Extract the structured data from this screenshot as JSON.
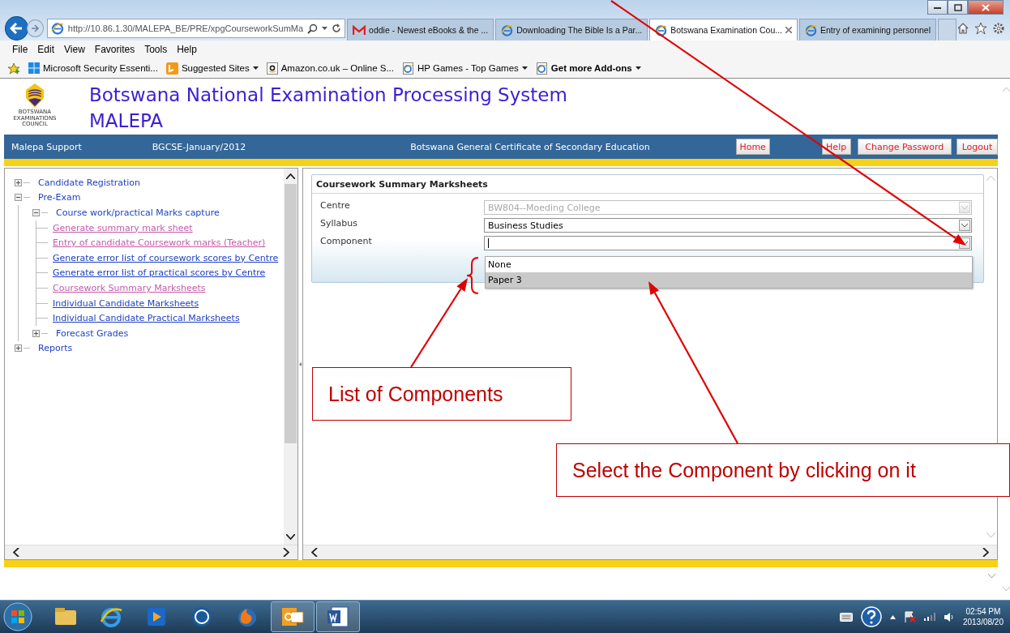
{
  "browser": {
    "address": "http://10.86.1.30/MALEPA_BE/PRE/xpgCourseworkSumMa",
    "tabs": [
      {
        "label": "oddie - Newest eBooks & the ...",
        "kind": "mail",
        "selected": false
      },
      {
        "label": "Downloading The Bible Is a Par...",
        "kind": "web",
        "selected": false
      },
      {
        "label": "Botswana Examination Cou...",
        "kind": "web",
        "selected": true
      },
      {
        "label": "Entry of examining personnel",
        "kind": "web",
        "selected": false
      }
    ],
    "menu": [
      "File",
      "Edit",
      "View",
      "Favorites",
      "Tools",
      "Help"
    ],
    "favorites": [
      {
        "label": "Microsoft Security Essenti...",
        "kind": "windows",
        "has_menu": false,
        "bold": false
      },
      {
        "label": "Suggested Sites",
        "kind": "bing",
        "has_menu": true,
        "bold": false
      },
      {
        "label": "Amazon.co.uk – Online S...",
        "kind": "amazon",
        "has_menu": false,
        "bold": false
      },
      {
        "label": "HP Games - Top Games",
        "kind": "page",
        "has_menu": true,
        "bold": false
      },
      {
        "label": "Get more Add-ons",
        "kind": "page",
        "has_menu": true,
        "bold": true
      }
    ]
  },
  "header": {
    "logo_caption": "BOTSWANA EXAMINATIONS COUNCIL",
    "title": "Botswana National Examination Processing System",
    "subtitle": "MALEPA"
  },
  "nav_bar": {
    "items": [
      "Malepa Support",
      "BGCSE-January/2012",
      "Botswana General Certificate of Secondary Education"
    ],
    "buttons": [
      "Home",
      "Help",
      "Change Password",
      "Logout"
    ]
  },
  "tree": [
    {
      "label": "Candidate Registration",
      "expanded": false
    },
    {
      "label": "Pre-Exam",
      "expanded": true,
      "children": [
        {
          "label": "Course work/practical Marks capture",
          "expanded": true,
          "children": [
            {
              "label": "Generate summary mark sheet",
              "visited": true
            },
            {
              "label": "Entry of candidate Coursework marks (Teacher)",
              "visited": true
            },
            {
              "label": "Generate error list of coursework scores by Centre",
              "visited": false
            },
            {
              "label": "Generate error list of practical scores by Centre",
              "visited": false
            },
            {
              "label": "Coursework Summary Marksheets",
              "visited": true
            },
            {
              "label": "Individual Candidate Marksheets",
              "visited": false
            },
            {
              "label": "Individual Candidate Practical Marksheets",
              "visited": false
            }
          ]
        },
        {
          "label": "Forecast Grades",
          "expanded": false
        }
      ]
    },
    {
      "label": "Reports",
      "expanded": false
    }
  ],
  "form": {
    "title": "Coursework Summary Marksheets",
    "fields": [
      {
        "label": "Centre",
        "value": "BW804--Moeding College",
        "disabled": true
      },
      {
        "label": "Syllabus",
        "value": "Business Studies",
        "disabled": false
      },
      {
        "label": "Component",
        "disabled": false
      }
    ],
    "component_options": [
      {
        "label": "None",
        "selected": false
      },
      {
        "label": "Paper 3",
        "selected": true
      }
    ]
  },
  "annotations": [
    {
      "text": "List of Components"
    },
    {
      "text": "Select the Component by clicking on it"
    }
  ],
  "taskbar": {
    "apps": [
      {
        "kind": "folder",
        "open": false
      },
      {
        "kind": "ie",
        "open": false
      },
      {
        "kind": "media",
        "open": false
      },
      {
        "kind": "hp",
        "open": false
      },
      {
        "kind": "firefox",
        "open": false
      },
      {
        "kind": "outlook",
        "open": true
      },
      {
        "kind": "word",
        "open": true
      }
    ],
    "time": "02:54 PM",
    "date": "2013/08/20"
  }
}
